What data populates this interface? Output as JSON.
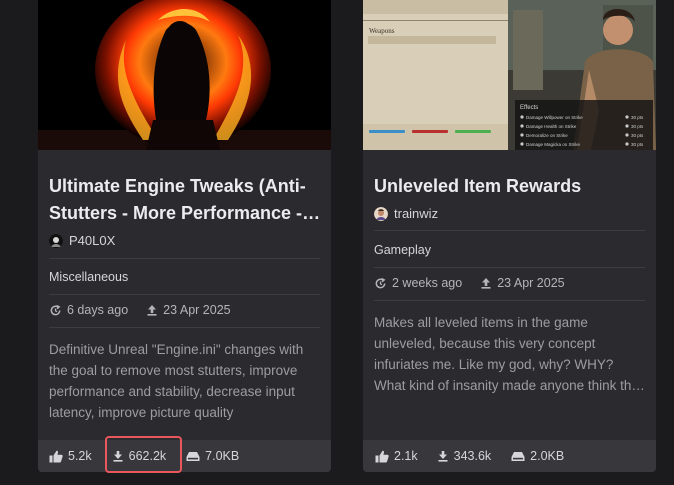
{
  "cards": [
    {
      "title": "Ultimate Engine Tweaks (Anti-Stutters - More Performance - Less Latency)",
      "author": "P40L0X",
      "category": "Miscellaneous",
      "updated": "6 days ago",
      "uploaded": "23 Apr 2025",
      "description": "Definitive Unreal \"Engine.ini\" changes with the goal to remove most stutters, improve performance and stability, decrease input latency, improve picture quality",
      "endorsements": "5.2k",
      "downloads": "662.2k",
      "size": "7.0KB"
    },
    {
      "title": "Unleveled Item Rewards",
      "author": "trainwiz",
      "category": "Gameplay",
      "updated": "2 weeks ago",
      "uploaded": "23 Apr 2025",
      "description": "Makes all leveled items in the game unleveled, because this very concept infuriates me. Like my god, why? WHY? What kind of insanity made anyone think this was a good idea",
      "endorsements": "2.1k",
      "downloads": "343.6k",
      "size": "2.0KB",
      "thumb_text": {
        "panel_title": "Weapons",
        "effects_title": "Effects",
        "effects": [
          "Damage Willpower on Strike",
          "Damage Health on Strike",
          "Demoralize on Strike",
          "Damage Magicka on Strike"
        ],
        "effect_values": [
          "30 pts",
          "30 pts",
          "30 pts",
          "30 pts"
        ]
      }
    }
  ],
  "colors": {
    "background": "#1b1b1e",
    "card": "#2b2b2f",
    "stats_bar": "#37373c",
    "highlight": "#e9565c"
  }
}
